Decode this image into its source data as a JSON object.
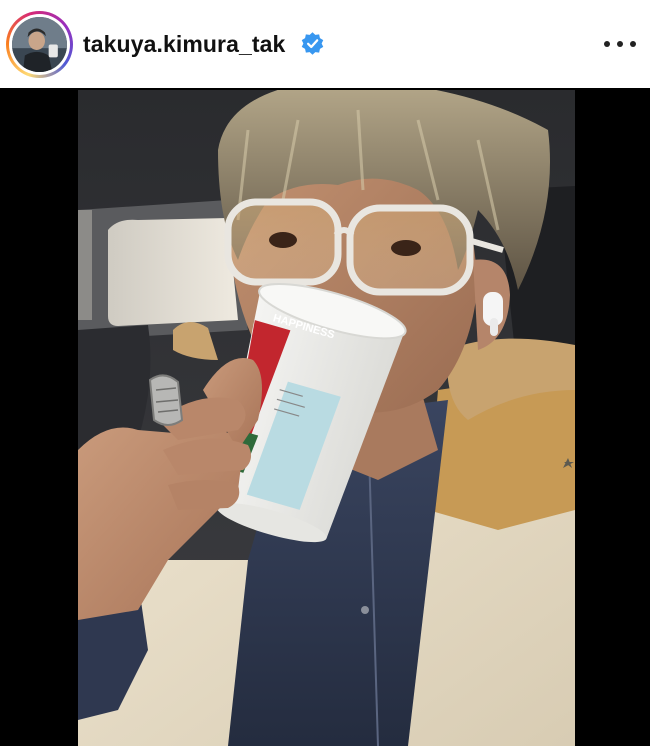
{
  "post": {
    "username": "takuya.kimura_tak",
    "verified": true,
    "more_icon": "more-horizontal-icon"
  },
  "colors": {
    "verified_blue": "#3897f0",
    "ring_gradient": [
      "#feda75",
      "#fa7e1e",
      "#d62976",
      "#962fbf",
      "#4f5bd5"
    ],
    "letterbox": "#000000"
  },
  "photo": {
    "cup_logo_text": "HAPPINESS"
  }
}
